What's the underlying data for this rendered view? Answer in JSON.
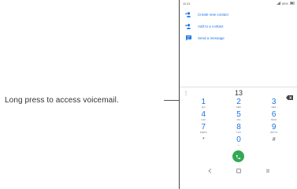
{
  "callout": {
    "text": "Long press to access voicemail."
  },
  "status_bar": {
    "time": "11:41",
    "battery": "85%"
  },
  "menu": {
    "items": [
      {
        "label": "Create new contact",
        "icon": "person-add-icon"
      },
      {
        "label": "Add to a contact",
        "icon": "person-add-icon"
      },
      {
        "label": "Send a message",
        "icon": "message-icon"
      }
    ]
  },
  "dialer": {
    "number": "13",
    "more_glyph": "⋮",
    "keys": [
      {
        "digit": "1",
        "letters": "QO"
      },
      {
        "digit": "2",
        "letters": "ABC"
      },
      {
        "digit": "3",
        "letters": "DEF"
      },
      {
        "digit": "4",
        "letters": "GHI"
      },
      {
        "digit": "5",
        "letters": "JKL"
      },
      {
        "digit": "6",
        "letters": "MNO"
      },
      {
        "digit": "7",
        "letters": "PQRS"
      },
      {
        "digit": "8",
        "letters": "TUV"
      },
      {
        "digit": "9",
        "letters": "WXYZ"
      },
      {
        "digit": "*",
        "letters": ""
      },
      {
        "digit": "0",
        "letters": "+"
      },
      {
        "digit": "#",
        "letters": ""
      }
    ]
  },
  "colors": {
    "accent": "#1a73e8",
    "call": "#34a853"
  }
}
